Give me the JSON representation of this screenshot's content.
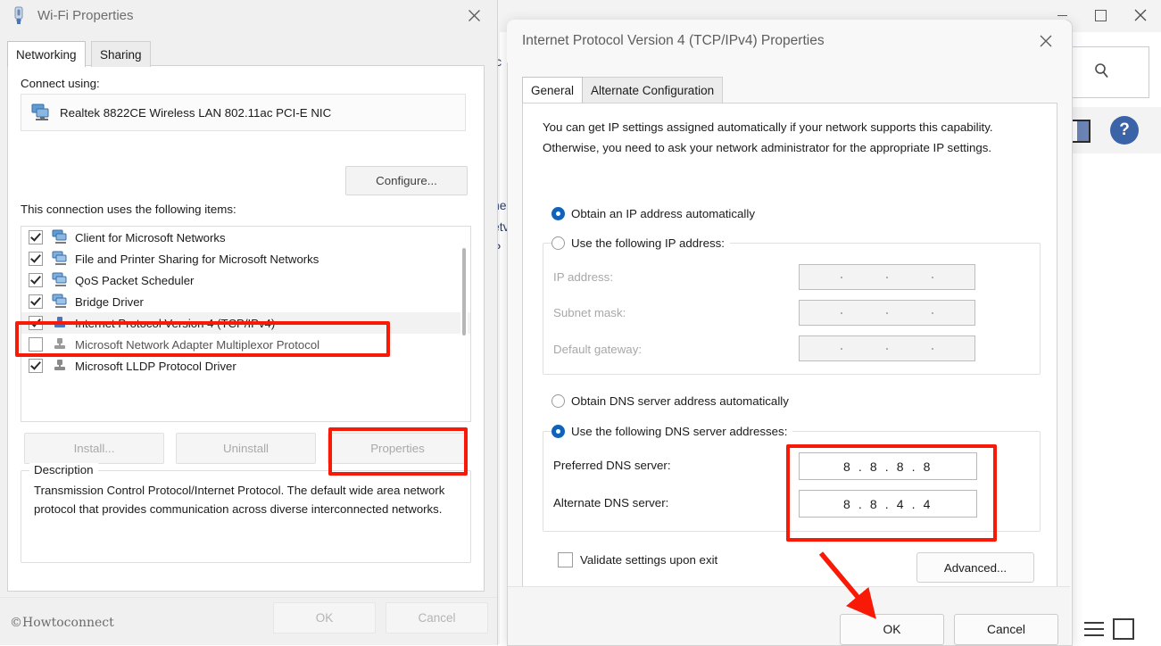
{
  "background_window": {
    "minimize_label": "—",
    "maximize_label": "□",
    "close_label": "✕",
    "search_icon": "search-icon",
    "help_icon": "help-icon",
    "split_view_icon": "split-view-icon",
    "hamburger_icon": "hamburger-icon",
    "sliver_fragments": [
      "ic",
      "ne",
      "etv",
      "P"
    ]
  },
  "wifi_window": {
    "title": "Wi-Fi Properties",
    "icon": "wifi-adapter-icon",
    "close_label": "✕",
    "tabs": [
      {
        "label": "Networking",
        "active": true
      },
      {
        "label": "Sharing",
        "active": false
      }
    ],
    "connect_using_label": "Connect using:",
    "adapter_name": "Realtek 8822CE Wireless LAN 802.11ac PCI-E NIC",
    "adapter_icon": "network-adapter-icon",
    "configure_button": "Configure...",
    "items_label": "This connection uses the following items:",
    "items": [
      {
        "label": "Client for Microsoft Networks",
        "checked": true,
        "selected": false,
        "icon": "client-service-icon"
      },
      {
        "label": "File and Printer Sharing for Microsoft Networks",
        "checked": true,
        "selected": false,
        "icon": "client-service-icon"
      },
      {
        "label": "QoS Packet Scheduler",
        "checked": true,
        "selected": false,
        "icon": "client-service-icon"
      },
      {
        "label": "Bridge Driver",
        "checked": true,
        "selected": false,
        "icon": "client-service-icon"
      },
      {
        "label": "Internet Protocol Version 4 (TCP/IPv4)",
        "checked": true,
        "selected": true,
        "icon": "protocol-icon"
      },
      {
        "label": "Microsoft Network Adapter Multiplexor Protocol",
        "checked": false,
        "selected": false,
        "icon": "protocol-icon"
      },
      {
        "label": "Microsoft LLDP Protocol Driver",
        "checked": true,
        "selected": false,
        "icon": "protocol-icon"
      }
    ],
    "install_button": "Install...",
    "uninstall_button": "Uninstall",
    "properties_button": "Properties",
    "description_legend": "Description",
    "description_text": "Transmission Control Protocol/Internet Protocol. The default wide area network protocol that provides communication across diverse interconnected networks.",
    "ok_button": "OK",
    "cancel_button": "Cancel",
    "watermark": "©Howtoconnect"
  },
  "ipv4_dialog": {
    "title": "Internet Protocol Version 4 (TCP/IPv4) Properties",
    "close_label": "✕",
    "tabs": [
      {
        "label": "General",
        "active": true
      },
      {
        "label": "Alternate Configuration",
        "active": false
      }
    ],
    "description": "You can get IP settings assigned automatically if your network supports this capability. Otherwise, you need to ask your network administrator for the appropriate IP settings.",
    "ip_section": {
      "radio_auto": {
        "label": "Obtain an IP address automatically",
        "selected": true
      },
      "radio_manual": {
        "label": "Use the following IP address:",
        "selected": false
      },
      "fields": [
        {
          "label": "IP address:",
          "value": ""
        },
        {
          "label": "Subnet mask:",
          "value": ""
        },
        {
          "label": "Default gateway:",
          "value": ""
        }
      ]
    },
    "dns_section": {
      "radio_auto": {
        "label": "Obtain DNS server address automatically",
        "selected": false
      },
      "radio_manual": {
        "label": "Use the following DNS server addresses:",
        "selected": true
      },
      "fields": [
        {
          "label": "Preferred DNS server:",
          "value": "8 . 8 . 8 . 8"
        },
        {
          "label": "Alternate DNS server:",
          "value": "8 . 8 . 4 . 4"
        }
      ]
    },
    "validate_checkbox": {
      "label": "Validate settings upon exit",
      "checked": false
    },
    "advanced_button": "Advanced...",
    "ok_button": "OK",
    "cancel_button": "Cancel"
  },
  "annotations": {
    "highlight_color": "#f81a07",
    "highlight_ipv4_item": "Internet Protocol Version 4 (TCP/IPv4)",
    "highlight_properties_button": "Properties",
    "highlight_dns_fields": "DNS server address fields",
    "arrow_target": "OK"
  }
}
